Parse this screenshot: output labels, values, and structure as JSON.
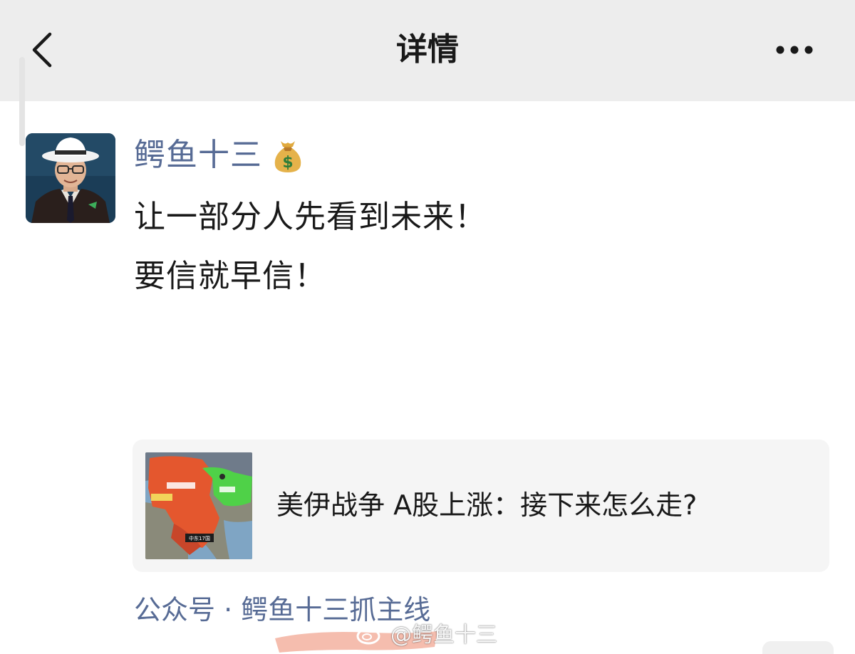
{
  "navbar": {
    "title": "详情",
    "back_icon": "chevron-left-icon",
    "more_icon": "more-dots-icon"
  },
  "post": {
    "author": "鳄鱼十三",
    "author_badge_icon": "money-bag-emoji-icon",
    "lines": [
      "让一部分人先看到未来！",
      "要信就早信！"
    ]
  },
  "article": {
    "title": "美伊战争 A股上涨：接下来怎么走?",
    "thumbnail_label": "中东17国"
  },
  "source": {
    "text": "公众号 · 鳄鱼十三抓主线"
  },
  "watermark": {
    "text": "@鳄鱼十三",
    "icon": "weibo-icon"
  },
  "colors": {
    "navbar_bg": "#ededed",
    "link_blue": "#576b95",
    "card_bg": "#f5f5f5",
    "text_primary": "#191919"
  }
}
